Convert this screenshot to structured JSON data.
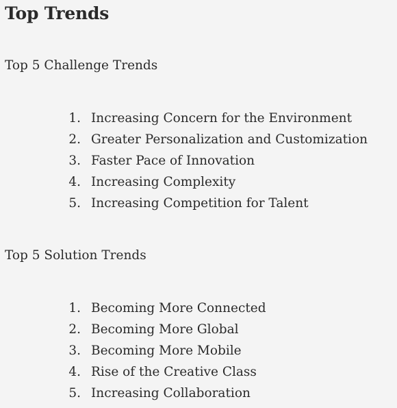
{
  "page": {
    "title": "Top Trends"
  },
  "challenge": {
    "heading": "Top 5 Challenge Trends",
    "items": [
      {
        "num": "1.",
        "label": "Increasing Concern for the Environment"
      },
      {
        "num": "2.",
        "label": "Greater Personalization and Customization"
      },
      {
        "num": "3.",
        "label": "Faster Pace of Innovation"
      },
      {
        "num": "4.",
        "label": "Increasing Complexity"
      },
      {
        "num": "5.",
        "label": "Increasing Competition for Talent"
      }
    ]
  },
  "solution": {
    "heading": "Top 5 Solution Trends",
    "items": [
      {
        "num": "1.",
        "label": "Becoming More Connected"
      },
      {
        "num": "2.",
        "label": "Becoming More Global"
      },
      {
        "num": "3.",
        "label": "Becoming More Mobile"
      },
      {
        "num": "4.",
        "label": "Rise of the Creative Class"
      },
      {
        "num": "5.",
        "label": "Increasing Collaboration"
      }
    ]
  }
}
